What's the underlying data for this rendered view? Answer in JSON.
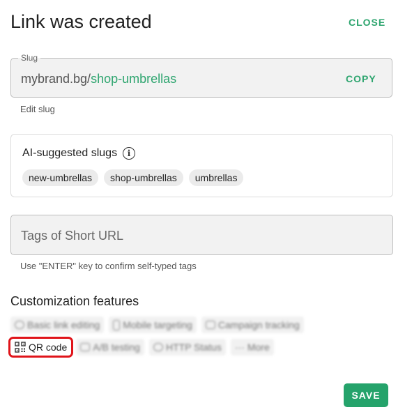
{
  "dialog": {
    "title": "Link was created",
    "close_label": "CLOSE"
  },
  "slug": {
    "legend": "Slug",
    "domain": "mybrand.bg/",
    "value": "shop-umbrellas",
    "copy_label": "COPY",
    "helper": "Edit slug"
  },
  "ai_suggestions": {
    "title": "AI-suggested slugs",
    "info_icon": "info-icon",
    "chips": [
      "new-umbrellas",
      "shop-umbrellas",
      "umbrellas"
    ]
  },
  "tags": {
    "placeholder": "Tags of Short URL",
    "helper": "Use \"ENTER\" key to confirm self-typed tags"
  },
  "customization": {
    "title": "Customization features",
    "row1": [
      {
        "label": "Basic link editing",
        "icon": "link-icon"
      },
      {
        "label": "Mobile targeting",
        "icon": "mobile-icon"
      },
      {
        "label": "Campaign tracking",
        "icon": "megaphone-icon"
      }
    ],
    "row2": [
      {
        "label": "QR code",
        "icon": "qr-code-icon"
      },
      {
        "label": "A/B testing",
        "icon": "ab-testing-icon"
      },
      {
        "label": "HTTP Status",
        "icon": "http-status-icon"
      },
      {
        "label": "More",
        "icon": "more-icon"
      }
    ],
    "highlight_color": "#e0141a"
  },
  "footer": {
    "save_label": "SAVE"
  },
  "colors": {
    "accent": "#2ea56f",
    "save_bg": "#25a36b"
  }
}
